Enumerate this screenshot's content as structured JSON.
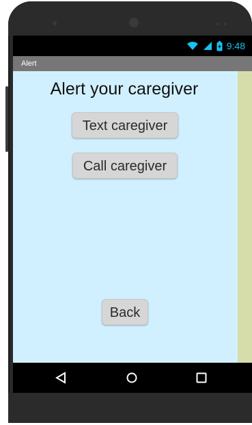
{
  "status_bar": {
    "time": "9:48",
    "icons": [
      "wifi-icon",
      "signal-icon",
      "battery-icon"
    ],
    "color": "#17c2ee"
  },
  "action_bar": {
    "title": "Alert"
  },
  "main": {
    "heading": "Alert your caregiver",
    "buttons": {
      "text": "Text caregiver",
      "call": "Call caregiver",
      "back": "Back"
    }
  },
  "navigation": {
    "icons": [
      "back-nav-icon",
      "home-nav-icon",
      "recents-nav-icon"
    ]
  },
  "colors": {
    "screen_background": "#d1f0ff",
    "right_strip": "#d7ddaa",
    "action_bar": "#777777",
    "button": "#d6d6d6"
  }
}
